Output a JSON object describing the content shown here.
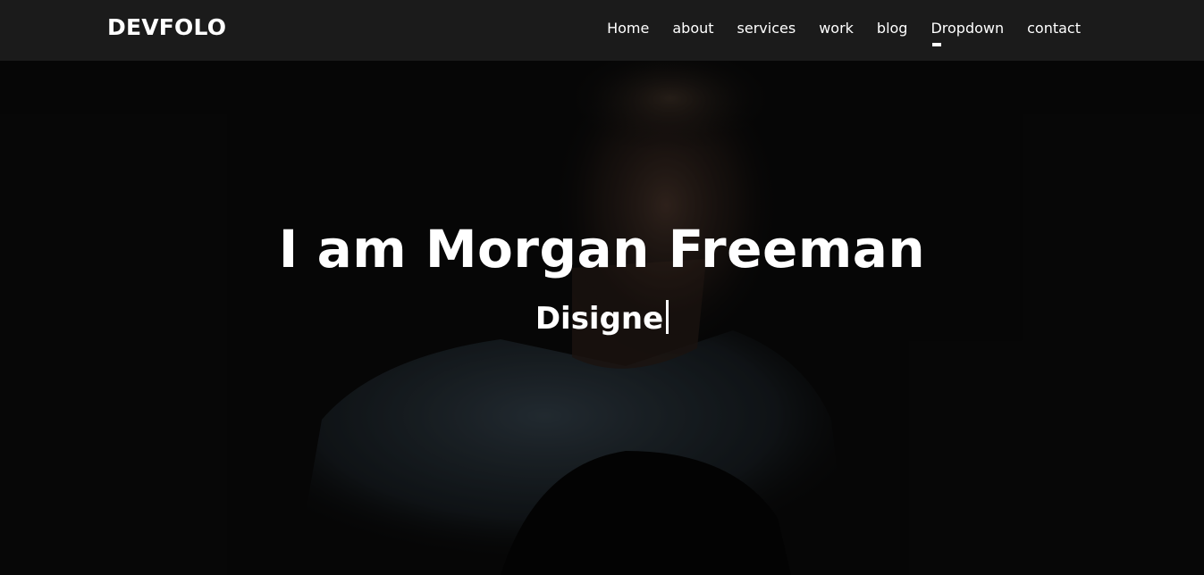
{
  "navbar": {
    "brand": "DEVFOLO",
    "items": [
      {
        "label": "Home"
      },
      {
        "label": "about"
      },
      {
        "label": "services"
      },
      {
        "label": "work"
      },
      {
        "label": "blog"
      },
      {
        "label": "Dropdown",
        "active": true
      },
      {
        "label": "contact"
      }
    ]
  },
  "hero": {
    "title": "I am Morgan Freeman",
    "subtitle": "Disigne"
  },
  "colors": {
    "navbar_bg": "#1b1b1b",
    "hero_bg": "#0a0a0a",
    "text": "#ffffff"
  }
}
